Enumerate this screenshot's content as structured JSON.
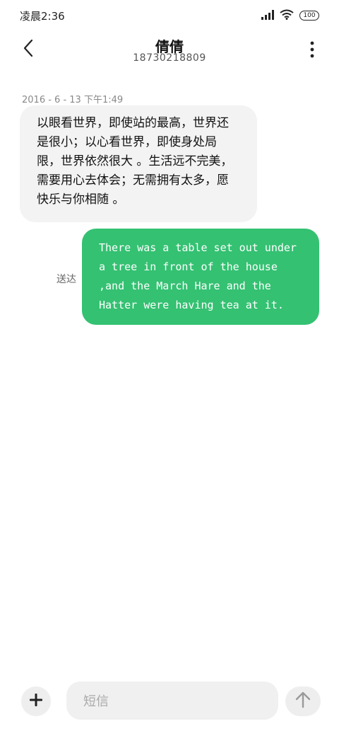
{
  "status_bar": {
    "time": "凌晨2:36",
    "battery": "100",
    "icons": [
      "signal-icon",
      "wifi-icon",
      "battery-icon"
    ]
  },
  "header": {
    "contact_name": "倩倩",
    "contact_number": "18730218809",
    "icons": [
      "back-icon",
      "more-icon"
    ]
  },
  "conversation": {
    "timestamp": "2016 - 6 - 13 下午1:49",
    "messages": [
      {
        "direction": "incoming",
        "text": "以眼看世界，即使站的最高，世界还是很小；以心看世界，即使身处局限，世界依然很大 。生活远不完美，需要用心去体会；无需拥有太多，愿快乐与你相随 。"
      },
      {
        "direction": "outgoing",
        "status": "送达",
        "text": "There was a table set out under a tree in front of the house ,and the March Hare and the Hatter were having tea at it."
      }
    ]
  },
  "composer": {
    "placeholder": "短信",
    "icons": [
      "plus-icon",
      "send-arrow-icon"
    ]
  },
  "colors": {
    "outgoing_bubble": "#34c172",
    "incoming_bubble": "#f3f3f3",
    "background": "#ffffff"
  }
}
